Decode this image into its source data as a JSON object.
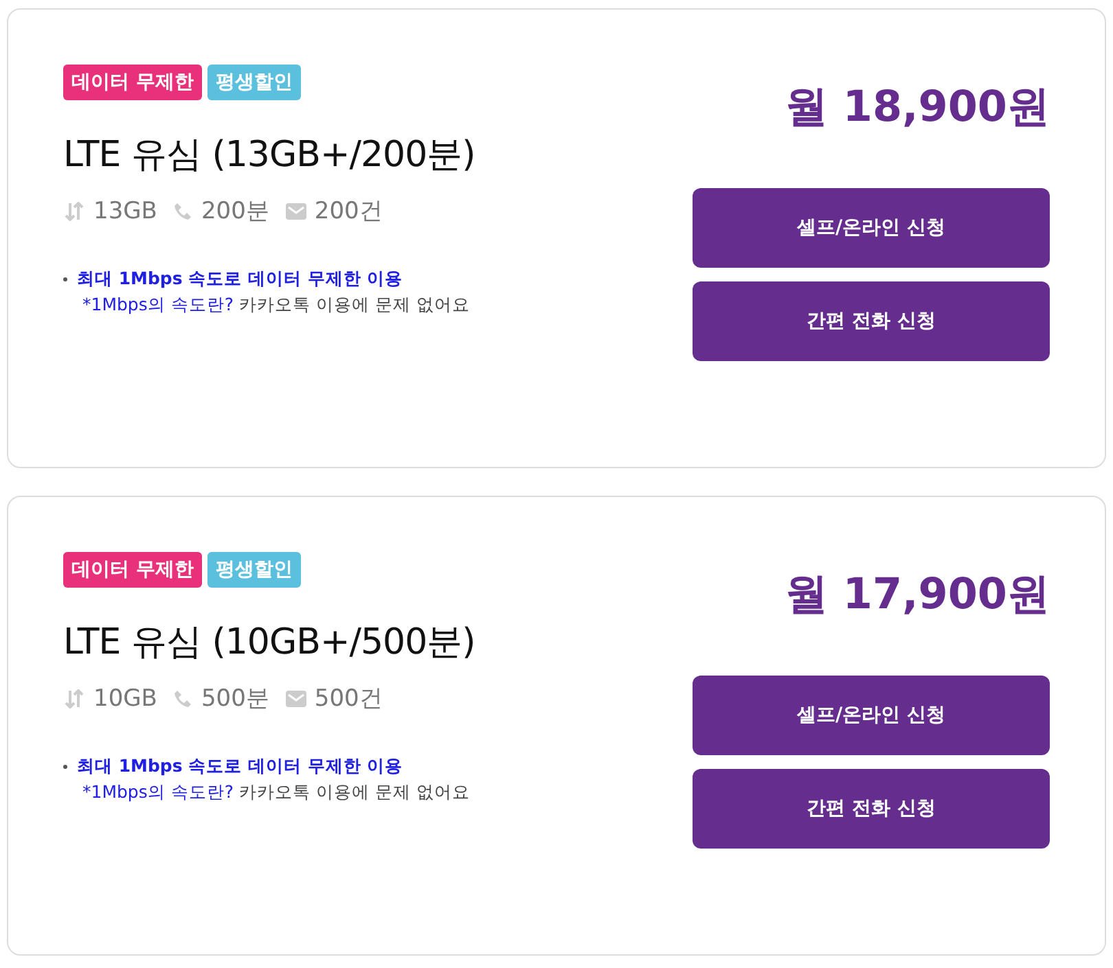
{
  "plans": [
    {
      "tags": [
        {
          "label": "데이터 무제한",
          "color": "#e8317a"
        },
        {
          "label": "평생할인",
          "color": "#5bc0de"
        }
      ],
      "title": "LTE 유심 (13GB+/200분)",
      "specs": [
        {
          "kind": "data",
          "text": "13GB"
        },
        {
          "kind": "call",
          "text": "200분"
        },
        {
          "kind": "sms",
          "text": "200건"
        }
      ],
      "note": {
        "headline": "최대 1Mbps 속도로 데이터 무제한 이용",
        "question": "*1Mbps의 속도란?",
        "answer": "카카오톡 이용에 문제 없어요"
      },
      "price": "월 18,900원",
      "buttons": [
        "셀프/온라인 신청",
        "간편 전화 신청"
      ]
    },
    {
      "tags": [
        {
          "label": "데이터 무제한",
          "color": "#e8317a"
        },
        {
          "label": "평생할인",
          "color": "#5bc0de"
        }
      ],
      "title": "LTE 유심 (10GB+/500분)",
      "specs": [
        {
          "kind": "data",
          "text": "10GB"
        },
        {
          "kind": "call",
          "text": "500분"
        },
        {
          "kind": "sms",
          "text": "500건"
        }
      ],
      "note": {
        "headline": "최대 1Mbps 속도로 데이터 무제한 이용",
        "question": "*1Mbps의 속도란?",
        "answer": "카카오톡 이용에 문제 없어요"
      },
      "price": "월 17,900원",
      "buttons": [
        "셀프/온라인 신청",
        "간편 전화 신청"
      ]
    }
  ]
}
